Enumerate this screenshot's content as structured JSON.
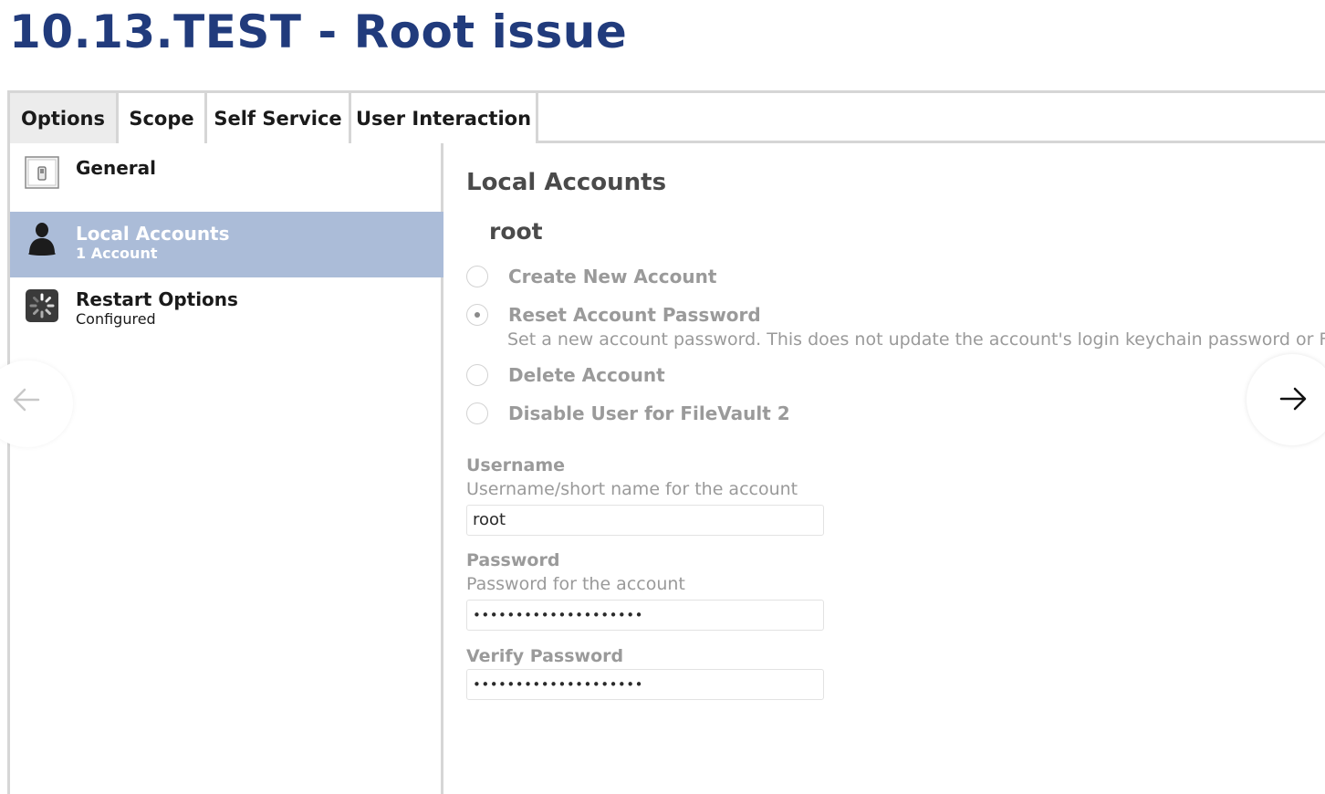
{
  "page": {
    "title": "10.13.TEST - Root issue"
  },
  "tabs": [
    {
      "label": "Options",
      "active": true
    },
    {
      "label": "Scope",
      "active": false
    },
    {
      "label": "Self Service",
      "active": false
    },
    {
      "label": "User Interaction",
      "active": false
    }
  ],
  "sidebar": {
    "items": [
      {
        "label": "General",
        "sub": "",
        "icon": "switch-icon",
        "selected": false
      },
      {
        "label": "Local Accounts",
        "sub": "1 Account",
        "icon": "user-silhouette-icon",
        "selected": true
      },
      {
        "label": "Restart Options",
        "sub": "Configured",
        "icon": "restart-spinner-icon",
        "selected": false
      }
    ]
  },
  "main": {
    "section_title": "Local Accounts",
    "account_name": "root",
    "options": [
      {
        "label": "Create New Account",
        "selected": false
      },
      {
        "label": "Reset Account Password",
        "selected": true,
        "description": "Set a new account password. This does not update the account's login keychain password or Fil"
      },
      {
        "label": "Delete Account",
        "selected": false
      },
      {
        "label": "Disable User for FileVault 2",
        "selected": false
      }
    ],
    "fields": {
      "username": {
        "label": "Username",
        "help": "Username/short name for the account",
        "value": "root"
      },
      "password": {
        "label": "Password",
        "help": "Password for the account",
        "value": "••••••••••••••••••••"
      },
      "verify": {
        "label": "Verify Password",
        "value": "••••••••••••••••••••"
      }
    }
  },
  "nav": {
    "prev_icon": "arrow-left-icon",
    "next_icon": "arrow-right-icon"
  },
  "colors": {
    "title": "#213b7c",
    "selected_row": "#abbcd8",
    "disabled_text": "#9a9a9a"
  }
}
